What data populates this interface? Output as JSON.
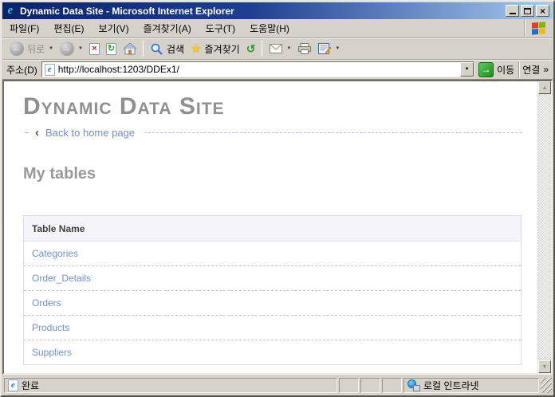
{
  "window": {
    "title": "Dynamic Data Site - Microsoft Internet Explorer"
  },
  "menu": {
    "items": [
      "파일(F)",
      "편집(E)",
      "보기(V)",
      "즐겨찾기(A)",
      "도구(T)",
      "도움말(H)"
    ]
  },
  "toolbar": {
    "back_label": "뒤로",
    "search_label": "검색",
    "favorites_label": "즐겨찾기"
  },
  "address_bar": {
    "label": "주소(D)",
    "url": "http://localhost:1203/DDEx1/",
    "go_label": "이동",
    "links_label": "연결",
    "chevron": "»"
  },
  "page": {
    "site_title": "Dynamic Data Site",
    "back_link": "Back to home page",
    "heading": "My tables",
    "table": {
      "header": "Table Name",
      "rows": [
        "Categories",
        "Order_Details",
        "Orders",
        "Products",
        "Suppliers"
      ]
    }
  },
  "status_bar": {
    "status": "완료",
    "zone": "로컬 인트라넷"
  },
  "icons": {
    "ie_e": "e",
    "back_arrow": "←",
    "forward_arrow": "→",
    "dropdown": "▼",
    "stop_x": "×",
    "refresh": "↻",
    "history": "↺",
    "star": "★",
    "close": "×",
    "scroll_up": "▲",
    "scroll_down": "▼",
    "go_arrow": "→",
    "back_chevron": "‹"
  },
  "colors": {
    "titlebar_start": "#0a246a",
    "titlebar_end": "#a6caf0",
    "link": "#7291c8",
    "table_header_bg": "#f4f4fa",
    "chrome": "#d6d2c9"
  }
}
